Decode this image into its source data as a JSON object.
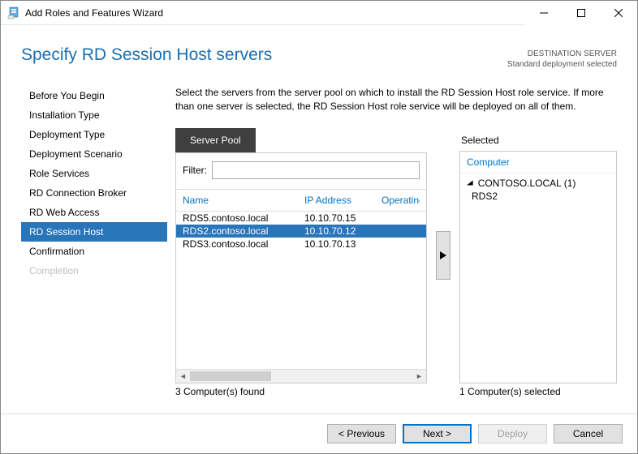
{
  "window": {
    "title": "Add Roles and Features Wizard"
  },
  "header": {
    "page_title": "Specify RD Session Host servers",
    "dest_label": "DESTINATION SERVER",
    "dest_value": "Standard deployment selected"
  },
  "nav": {
    "items": [
      {
        "label": "Before You Begin",
        "selected": false,
        "disabled": false
      },
      {
        "label": "Installation Type",
        "selected": false,
        "disabled": false
      },
      {
        "label": "Deployment Type",
        "selected": false,
        "disabled": false
      },
      {
        "label": "Deployment Scenario",
        "selected": false,
        "disabled": false
      },
      {
        "label": "Role Services",
        "selected": false,
        "disabled": false
      },
      {
        "label": "RD Connection Broker",
        "selected": false,
        "disabled": false
      },
      {
        "label": "RD Web Access",
        "selected": false,
        "disabled": false
      },
      {
        "label": "RD Session Host",
        "selected": true,
        "disabled": false
      },
      {
        "label": "Confirmation",
        "selected": false,
        "disabled": false
      },
      {
        "label": "Completion",
        "selected": false,
        "disabled": true
      }
    ]
  },
  "description": "Select the servers from the server pool on which to install the RD Session Host role service. If more than one server is selected, the RD Session Host role service will be deployed on all of them.",
  "pool": {
    "tab_label": "Server Pool",
    "filter_label": "Filter:",
    "filter_value": "",
    "columns": {
      "name": "Name",
      "ip": "IP Address",
      "os": "Operating"
    },
    "rows": [
      {
        "name": "RDS5.contoso.local",
        "ip": "10.10.70.15",
        "selected": false
      },
      {
        "name": "RDS2.contoso.local",
        "ip": "10.10.70.12",
        "selected": true
      },
      {
        "name": "RDS3.contoso.local",
        "ip": "10.10.70.13",
        "selected": false
      }
    ],
    "status": "3 Computer(s) found"
  },
  "selected": {
    "label": "Selected",
    "header": "Computer",
    "group_name": "CONTOSO.LOCAL (1)",
    "items": [
      "RDS2"
    ],
    "status": "1 Computer(s) selected"
  },
  "buttons": {
    "previous": "< Previous",
    "next": "Next >",
    "deploy": "Deploy",
    "cancel": "Cancel"
  }
}
